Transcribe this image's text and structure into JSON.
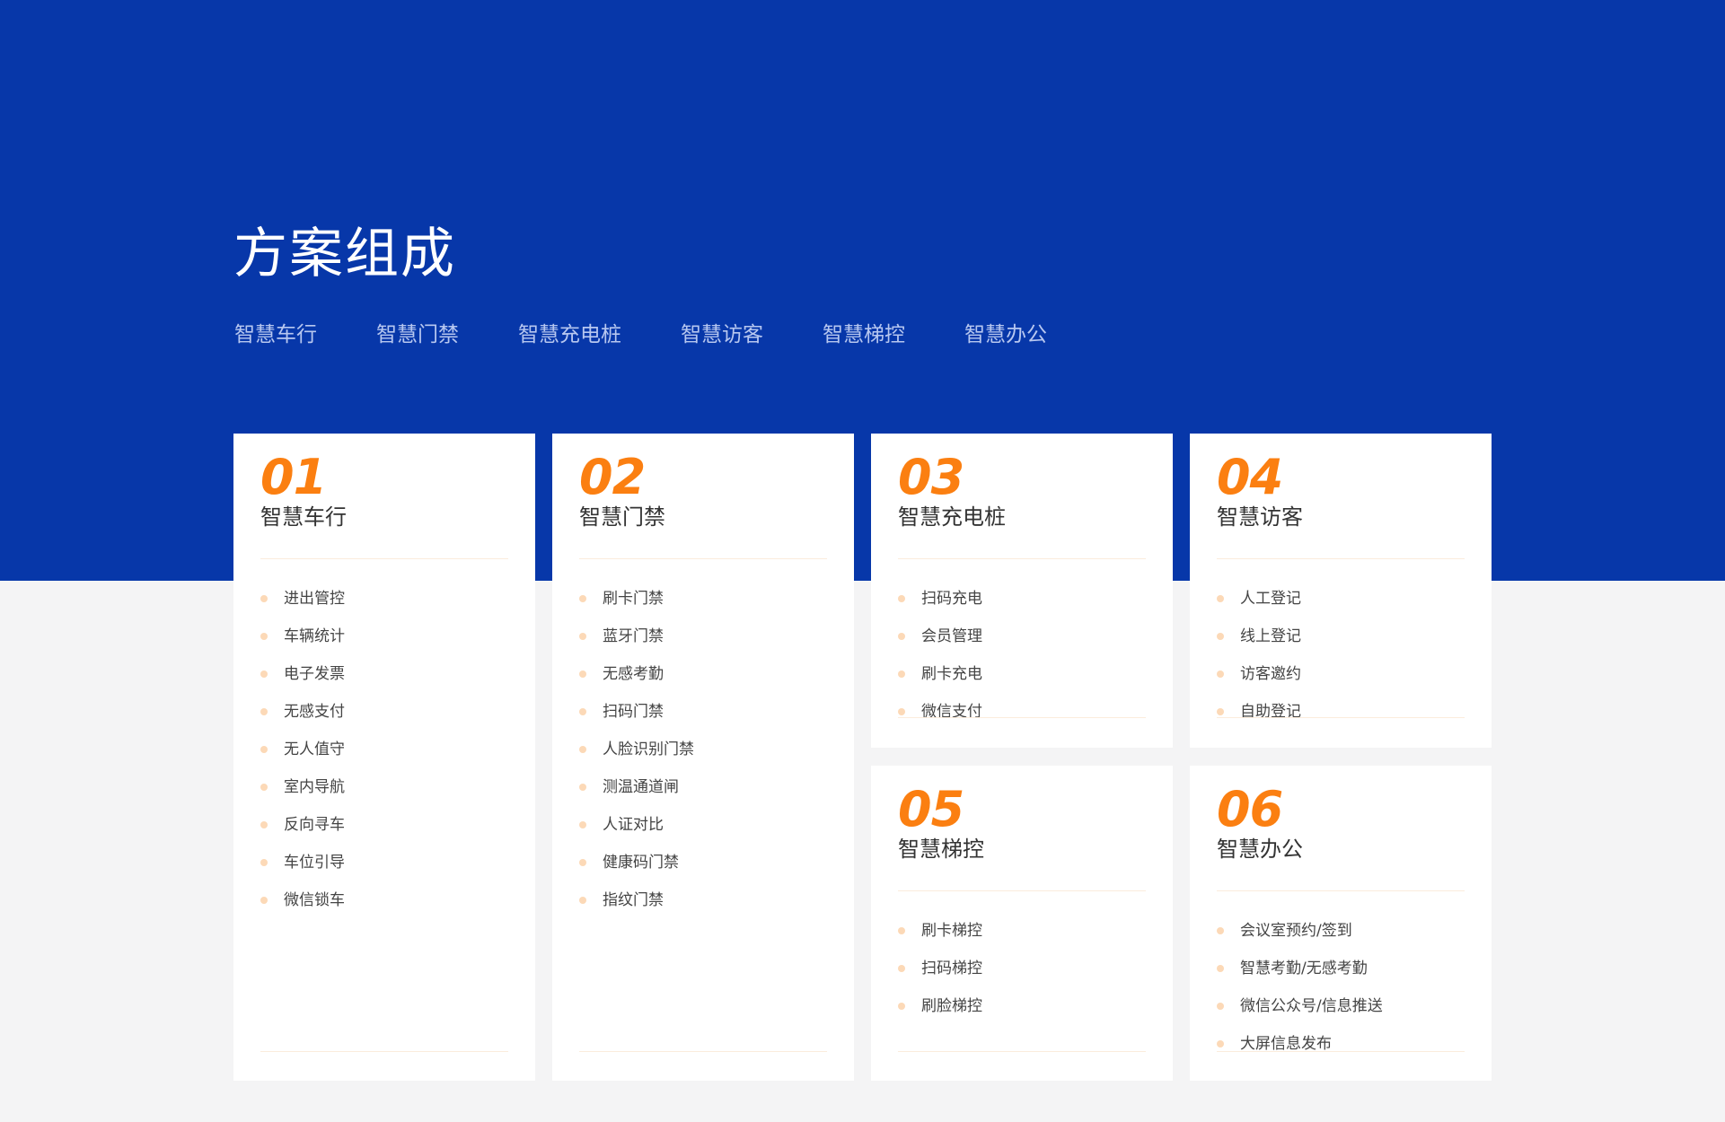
{
  "title": "方案组成",
  "nav": [
    "智慧车行",
    "智慧门禁",
    "智慧充电桩",
    "智慧访客",
    "智慧梯控",
    "智慧办公"
  ],
  "cards": [
    {
      "num": "01",
      "title": "智慧车行",
      "items": [
        "进出管控",
        "车辆统计",
        "电子发票",
        "无感支付",
        "无人值守",
        "室内导航",
        "反向寻车",
        "车位引导",
        "微信锁车"
      ]
    },
    {
      "num": "02",
      "title": "智慧门禁",
      "items": [
        "刷卡门禁",
        "蓝牙门禁",
        "无感考勤",
        "扫码门禁",
        "人脸识别门禁",
        "测温通道闸",
        "人证对比",
        "健康码门禁",
        "指纹门禁"
      ]
    },
    {
      "num": "03",
      "title": "智慧充电桩",
      "items": [
        "扫码充电",
        "会员管理",
        "刷卡充电",
        "微信支付"
      ]
    },
    {
      "num": "04",
      "title": "智慧访客",
      "items": [
        "人工登记",
        "线上登记",
        "访客邀约",
        "自助登记"
      ]
    },
    {
      "num": "05",
      "title": "智慧梯控",
      "items": [
        "刷卡梯控",
        "扫码梯控",
        "刷脸梯控"
      ]
    },
    {
      "num": "06",
      "title": "智慧办公",
      "items": [
        "会议室预约/签到",
        "智慧考勤/无感考勤",
        "微信公众号/信息推送",
        "大屏信息发布"
      ]
    }
  ],
  "colors": {
    "hero": "#0737a9",
    "accent": "#fb7f11",
    "bullet": "#fcd9b7",
    "background": "#f4f4f5"
  }
}
